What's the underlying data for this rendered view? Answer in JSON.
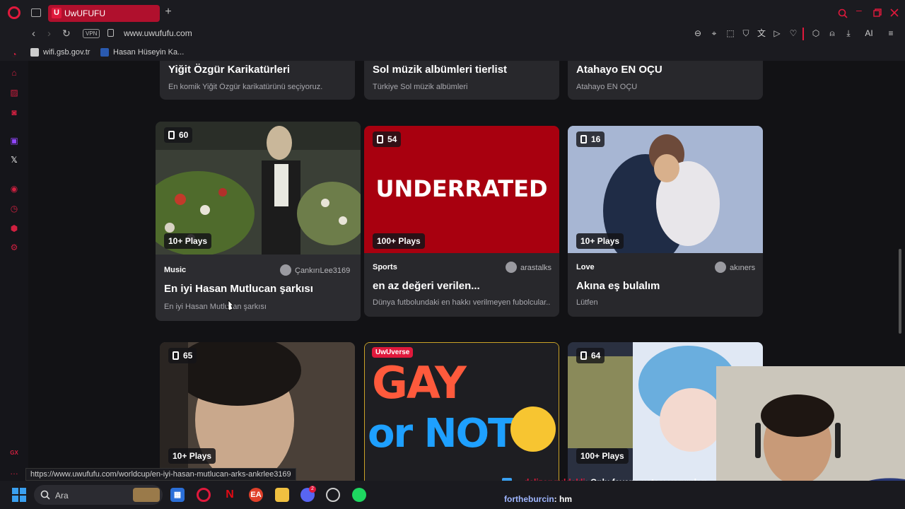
{
  "browser": {
    "tab_title": "UwUFUFU",
    "tab_favicon_letter": "U",
    "url": "www.uwufufu.com",
    "vpn_label": "VPN",
    "ai_label": "AI"
  },
  "bookmarks": [
    {
      "label": "wifi.gsb.gov.tr"
    },
    {
      "label": "Hasan Hüseyin Ka..."
    }
  ],
  "top_row": [
    {
      "title": "Yiğit Özgür Karikatürleri",
      "desc": "En komik Yiğit Özgür karikatürünü seçiyoruz."
    },
    {
      "title": "Sol müzik albümleri tierlist",
      "desc": "Türkiye Sol müzik albümleri"
    },
    {
      "title": "Atahayo EN OÇU",
      "desc": "Atahayo EN OÇU"
    }
  ],
  "cards": [
    {
      "count": "60",
      "plays": "10+ Plays",
      "category": "Music",
      "user": "ÇankırıLee3169",
      "title": "En iyi Hasan Mutlucan şarkısı",
      "desc": "En iyi Hasan Mutlucan şarkısı"
    },
    {
      "count": "54",
      "plays": "100+ Plays",
      "category": "Sports",
      "user": "arastalks",
      "title": "en az değeri verilen...",
      "desc": "Dünya futbolundaki en hakkı verilmeyen fubolcular...",
      "banner": "UNDERRATED"
    },
    {
      "count": "16",
      "plays": "10+ Plays",
      "category": "Love",
      "user": "akıners",
      "title": "Akına eş bulalım",
      "desc": "Lütfen"
    }
  ],
  "bottom_row": [
    {
      "count": "65",
      "plays": "10+ Plays"
    },
    {
      "badge": "UwUverse",
      "banner_top": "GAY",
      "banner_bottom": "or NOT"
    },
    {
      "count": "64",
      "plays": "100+ Plays"
    }
  ],
  "status_url": "https://www.uwufufu.com/worldcup/en-iyi-hasan-mutlucan-arks-ankrlee3169",
  "stream_chat": [
    {
      "user": "delizonguldakli",
      "message": ": Onlu fayans ustası yorumları"
    },
    {
      "user": "fortheburcin",
      "message": ": hm"
    }
  ],
  "taskbar": {
    "search_placeholder": "Ara",
    "discord_badge": "2"
  },
  "colors": {
    "accent": "#e0193c",
    "tab_bg": "#b0102d",
    "underrated_bg": "#a8000f",
    "card_bg": "#28282c"
  }
}
